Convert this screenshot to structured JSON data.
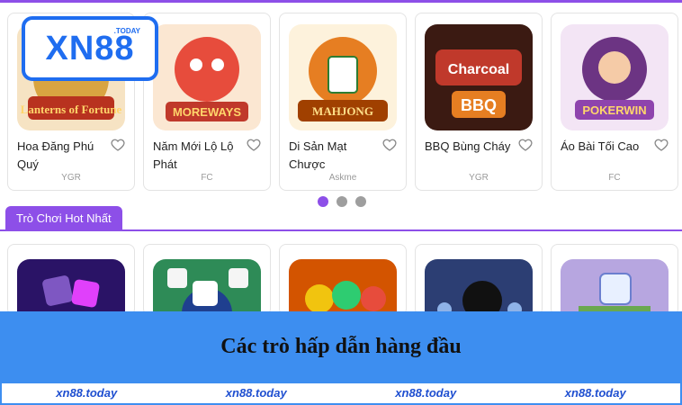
{
  "logo": {
    "text": "XN88",
    "sub": ".TODAY"
  },
  "games_row1": [
    {
      "name": "Hoa Đăng Phú Quý",
      "provider": "YGR",
      "icon": "lanterns-of-fortune-thumbnail",
      "color": "#c0392b"
    },
    {
      "name": "Năm Mới Lộ Lộ Phát",
      "provider": "FC",
      "icon": "chinese-new-year-moreways-thumbnail",
      "color": "#e74c3c"
    },
    {
      "name": "Di Sản Mạt Chược",
      "provider": "Askme",
      "icon": "mahjong-legacy-thumbnail",
      "color": "#e67e22"
    },
    {
      "name": "BBQ Bùng Cháy",
      "provider": "YGR",
      "icon": "charcoal-bbq-thumbnail",
      "color": "#8e2b1e"
    },
    {
      "name": "Áo Bài Tối Cao",
      "provider": "FC",
      "icon": "poker-win-thumbnail",
      "color": "#6c3483"
    }
  ],
  "carousel": {
    "active_index": 0,
    "count": 3
  },
  "section": {
    "title": "Trò Chơi Hot Nhất"
  },
  "games_row2": [
    {
      "icon": "neon-dice-thumbnail",
      "color": "#3a1d8f"
    },
    {
      "icon": "dice-table-thumbnail",
      "color": "#2e8b57"
    },
    {
      "icon": "jelly-blocks-thumbnail",
      "color": "#d35400"
    },
    {
      "icon": "bomb-game-thumbnail",
      "color": "#2c3e73"
    },
    {
      "icon": "dice-cash-thumbnail",
      "color": "#8e7cc3"
    }
  ],
  "banner": {
    "text": "Các trò hấp dẫn hàng đầu"
  },
  "footer": {
    "links": [
      "xn88.today",
      "xn88.today",
      "xn88.today",
      "xn88.today"
    ]
  },
  "colors": {
    "accent": "#8d4fe8",
    "banner": "#3d8ef0",
    "logo": "#1f6df0"
  }
}
